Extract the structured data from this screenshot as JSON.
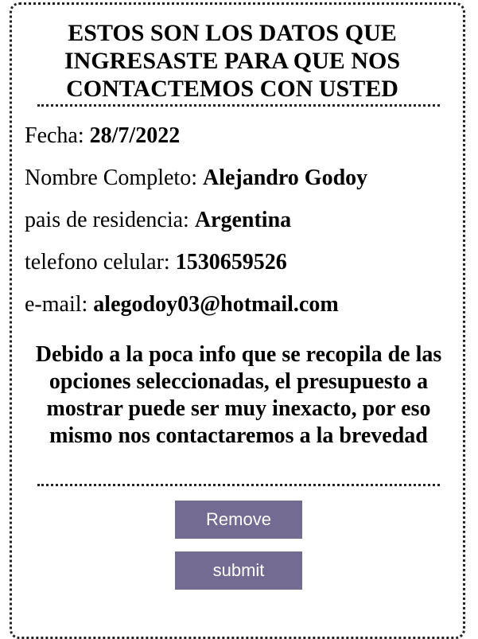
{
  "heading": "ESTOS SON LOS DATOS QUE INGRESASTE PARA QUE NOS CONTACTEMOS CON USTED",
  "fields": [
    {
      "label": "Fecha: ",
      "value": "28/7/2022"
    },
    {
      "label": "Nombre Completo: ",
      "value": "Alejandro Godoy"
    },
    {
      "label": "pais de residencia: ",
      "value": "Argentina"
    },
    {
      "label": "telefono celular: ",
      "value": "1530659526"
    },
    {
      "label": "e-mail: ",
      "value": "alegodoy03@hotmail.com"
    }
  ],
  "note": "Debido a la poca info que se recopila de las opciones seleccionadas, el presupuesto a mostrar puede ser muy inexacto, por eso mismo nos contactaremos a la brevedad",
  "buttons": {
    "remove": "Remove",
    "submit": "submit"
  },
  "colors": {
    "button_bg": "#736b91",
    "button_text": "#ffffff",
    "border": "#222222"
  }
}
